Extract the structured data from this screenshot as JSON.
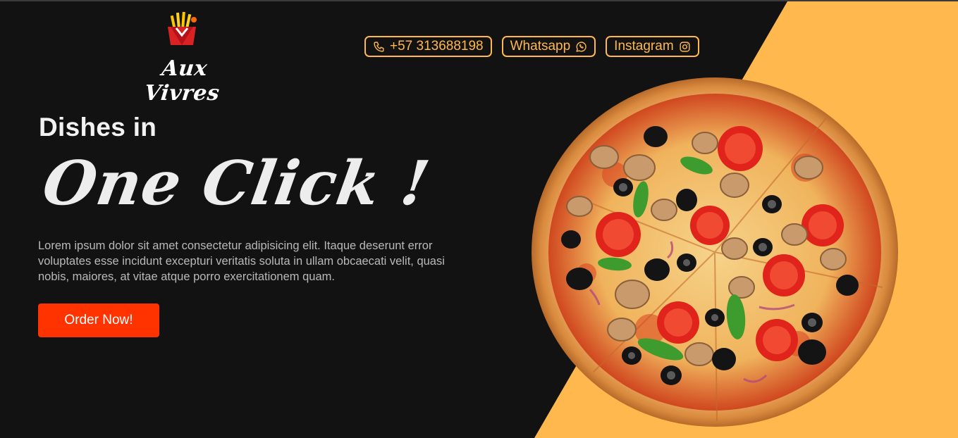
{
  "brand": {
    "name": "Aux Vivres",
    "icon": "fries-logo-icon"
  },
  "header": {
    "contacts": [
      {
        "label": "+57 313688198",
        "icon": "phone-icon"
      },
      {
        "label": "Whatsapp",
        "icon": "whatsapp-icon"
      },
      {
        "label": "Instagram",
        "icon": "instagram-icon"
      }
    ]
  },
  "hero": {
    "title_line1": "Dishes in",
    "title_line2": "One Click !",
    "description": "Lorem ipsum dolor sit amet consectetur adipisicing elit. Itaque deserunt error voluptates esse incidunt excepturi veritatis soluta in ullam obcaecati velit, quasi nobis, maiores, at vitae atque porro exercitationem quam.",
    "cta_label": "Order Now!",
    "image": "pizza-image"
  },
  "colors": {
    "background": "#121212",
    "accent": "#FFB84D",
    "cta": "#FF3300",
    "text_light": "#EDEDED",
    "text_muted": "#B9B9B9"
  }
}
